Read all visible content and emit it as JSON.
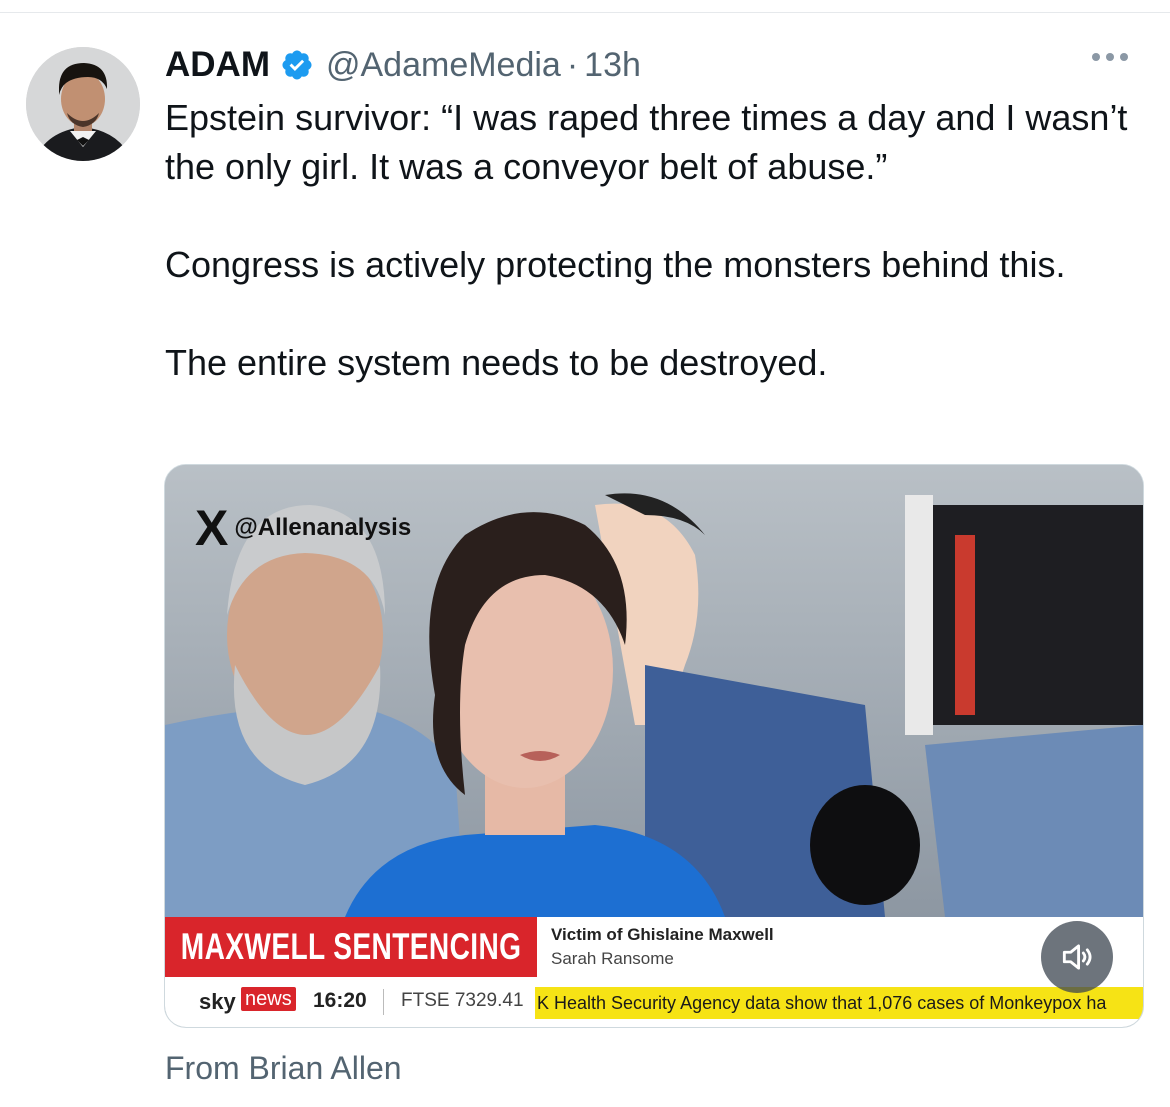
{
  "tweet": {
    "author_name": "ADAM",
    "handle": "@AdameMedia",
    "separator": "·",
    "timestamp": "13h",
    "text": [
      "Epstein survivor: “I was raped three times a day and I wasn’t the only girl. It was a conveyor belt of abuse.”",
      "Congress is actively protecting the monsters behind this.",
      "The entire system needs to be destroyed."
    ],
    "footer": "From Brian Allen"
  },
  "media": {
    "watermark_handle": "@Allenanalysis",
    "headline": "MAXWELL SENTENCING",
    "caption_line1": "Victim of Ghislaine Maxwell",
    "caption_line2": "Sarah Ransome",
    "channel_sky": "sky",
    "channel_news": "news",
    "clock": "16:20",
    "ftse": "FTSE 7329.41",
    "ticker": "K Health Security Agency data show that 1,076 cases of Monkeypox ha"
  },
  "icons": {
    "verified": "verified-badge-icon",
    "more": "more-options-icon",
    "sound": "volume-icon"
  },
  "colors": {
    "verified_blue": "#1d9bf0",
    "secondary_text": "#536471",
    "headline_red": "#d9252b",
    "ticker_yellow": "#f6e315"
  }
}
